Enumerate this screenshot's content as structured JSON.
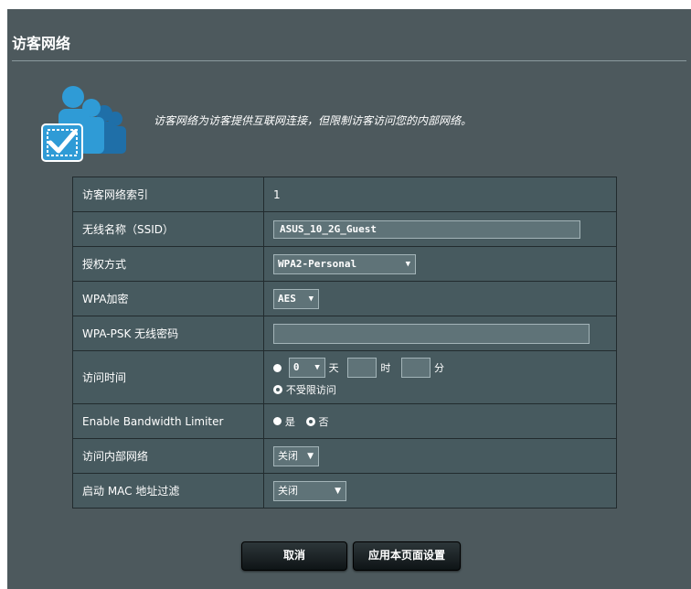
{
  "page": {
    "title": "访客网络"
  },
  "intro": {
    "description": "访客网络为访客提供互联网连接，但限制访客访问您的内部网络。"
  },
  "settings": {
    "index": {
      "label": "访客网络索引",
      "value": "1"
    },
    "ssid": {
      "label": "无线名称（SSID）",
      "value": "ASUS_10_2G_Guest"
    },
    "auth": {
      "label": "授权方式",
      "selected": "WPA2-Personal"
    },
    "encryption": {
      "label": "WPA加密",
      "selected": "AES"
    },
    "psk": {
      "label": "WPA-PSK 无线密码",
      "value": ""
    },
    "access_time": {
      "label": "访问时间",
      "day_value": "0",
      "day_unit": "天",
      "hour_unit": "时",
      "minute_unit": "分",
      "unlimited_label": "不受限访问"
    },
    "bandwidth": {
      "label": "Enable Bandwidth Limiter",
      "yes": "是",
      "no": "否"
    },
    "intranet": {
      "label": "访问内部网络",
      "selected": "关闭"
    },
    "mac_filter": {
      "label": "启动 MAC 地址过滤",
      "selected": "关闭"
    }
  },
  "actions": {
    "cancel": "取消",
    "apply": "应用本页面设置"
  },
  "colors": {
    "panel": "#4d595d",
    "row": "#475a5f",
    "field": "#5f7378",
    "icon_blue": "#2f9bd6"
  }
}
